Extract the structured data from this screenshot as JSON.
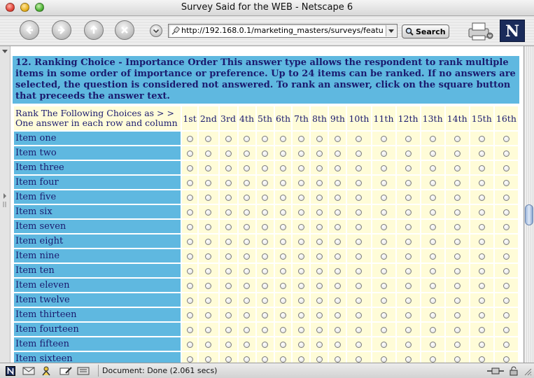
{
  "window": {
    "title": "Survey Said for the WEB - Netscape 6"
  },
  "toolbar": {
    "url": "http://192.168.0.1/marketing_masters/surveys/featu",
    "search_label": "Search",
    "logo_letter": "N"
  },
  "question": {
    "header": "12. Ranking Choice - Importance Order This answer type allows the respondent to rank multiple items in some order of importance or preference. Up to 24 items can be ranked. If no answers are selected, the question is considered not answered. To rank an answer, click on the square button that preceeds the answer text.",
    "instruction_line1": "Rank The Following Choices as > >",
    "instruction_line2": "One answer in each row and column",
    "ranks": [
      "1st",
      "2nd",
      "3rd",
      "4th",
      "5th",
      "6th",
      "7th",
      "8th",
      "9th",
      "10th",
      "11th",
      "12th",
      "13th",
      "14th",
      "15th",
      "16th"
    ],
    "items": [
      "Item one",
      "Item two",
      "Item three",
      "Item four",
      "Item five",
      "Item six",
      "Item seven",
      "Item eight",
      "Item nine",
      "Item ten",
      "Item eleven",
      "Item twelve",
      "Item thirteen",
      "Item fourteen",
      "Item fifteen",
      "Item sixteen"
    ]
  },
  "status": {
    "text": "Document: Done (2.061 secs)"
  },
  "colors": {
    "header_bg": "#5fb8e0",
    "cell_bg": "#fffcd8",
    "text": "#1a1a6e"
  }
}
